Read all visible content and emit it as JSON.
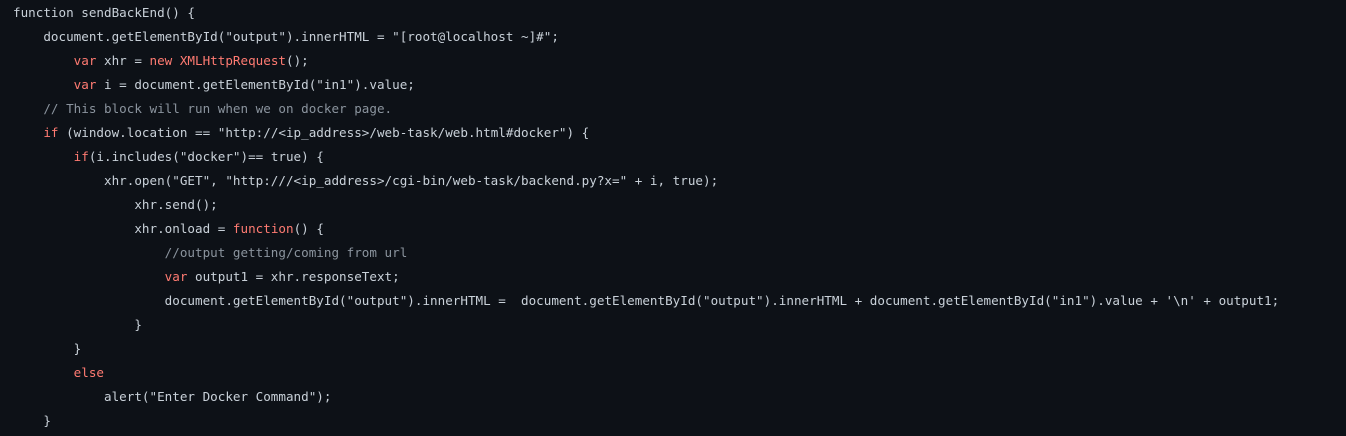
{
  "code": {
    "language": "javascript",
    "lines": [
      {
        "indent": 0,
        "tokens": [
          {
            "t": "function",
            "c": "plain"
          },
          {
            "t": " sendBackEnd() {",
            "c": "plain"
          }
        ]
      },
      {
        "indent": 4,
        "tokens": [
          {
            "t": "document.getElementById(\"output\").innerHTML = \"[root@localhost ~]#\";",
            "c": "plain"
          }
        ]
      },
      {
        "indent": 8,
        "tokens": [
          {
            "t": "var",
            "c": "kw"
          },
          {
            "t": " xhr = ",
            "c": "plain"
          },
          {
            "t": "new",
            "c": "kw"
          },
          {
            "t": " ",
            "c": "plain"
          },
          {
            "t": "XMLHttpRequest",
            "c": "kw"
          },
          {
            "t": "();",
            "c": "plain"
          }
        ]
      },
      {
        "indent": 8,
        "tokens": [
          {
            "t": "var",
            "c": "kw"
          },
          {
            "t": " i = document.getElementById(\"in1\").value;",
            "c": "plain"
          }
        ]
      },
      {
        "indent": 4,
        "tokens": [
          {
            "t": "// This block will run when we on docker page.",
            "c": "cmt"
          }
        ]
      },
      {
        "indent": 4,
        "tokens": [
          {
            "t": "if",
            "c": "kw"
          },
          {
            "t": " (window.location == \"http://<ip_address>/web-task/web.html#docker\") {",
            "c": "plain"
          }
        ]
      },
      {
        "indent": 8,
        "tokens": [
          {
            "t": "if",
            "c": "kw"
          },
          {
            "t": "(i.includes(\"docker\")== true) {",
            "c": "plain"
          }
        ]
      },
      {
        "indent": 12,
        "tokens": [
          {
            "t": "xhr.open(\"GET\", \"http:///<ip_address>/cgi-bin/web-task/backend.py?x=\" + i, true);",
            "c": "plain"
          }
        ]
      },
      {
        "indent": 16,
        "tokens": [
          {
            "t": "xhr.send();",
            "c": "plain"
          }
        ]
      },
      {
        "indent": 16,
        "tokens": [
          {
            "t": "xhr.onload = ",
            "c": "plain"
          },
          {
            "t": "function",
            "c": "kw"
          },
          {
            "t": "() {",
            "c": "plain"
          }
        ]
      },
      {
        "indent": 20,
        "tokens": [
          {
            "t": "//output getting/coming from url",
            "c": "cmt"
          }
        ]
      },
      {
        "indent": 20,
        "tokens": [
          {
            "t": "var",
            "c": "kw"
          },
          {
            "t": " output1 = xhr.responseText;",
            "c": "plain"
          }
        ]
      },
      {
        "indent": 20,
        "tokens": [
          {
            "t": "document.getElementById(\"output\").innerHTML =  document.getElementById(\"output\").innerHTML + document.getElementById(\"in1\").value + '\\n' + output1;",
            "c": "plain"
          }
        ]
      },
      {
        "indent": 16,
        "tokens": [
          {
            "t": "}",
            "c": "plain"
          }
        ]
      },
      {
        "indent": 8,
        "tokens": [
          {
            "t": "}",
            "c": "plain"
          }
        ]
      },
      {
        "indent": 8,
        "tokens": [
          {
            "t": "else",
            "c": "kw"
          }
        ]
      },
      {
        "indent": 12,
        "tokens": [
          {
            "t": "alert(\"Enter Docker Command\");",
            "c": "plain"
          }
        ]
      },
      {
        "indent": 4,
        "tokens": [
          {
            "t": "}",
            "c": "plain"
          }
        ]
      }
    ]
  },
  "colors": {
    "background": "#0d1117",
    "text": "#c9d1d9",
    "keyword": "#ff7b72",
    "comment": "#8b949e"
  }
}
